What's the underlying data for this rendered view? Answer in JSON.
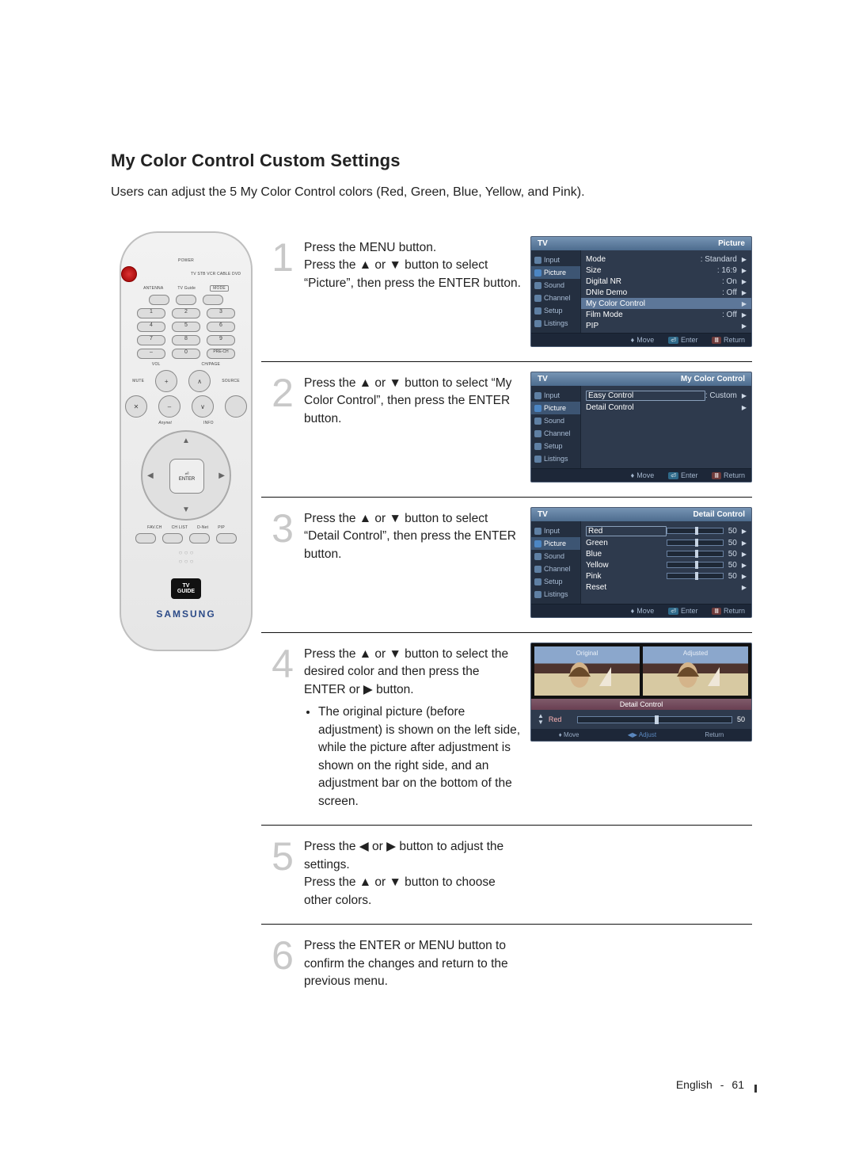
{
  "title": "My Color Control Custom Settings",
  "intro": "Users can adjust the 5 My Color Control colors (Red, Green, Blue, Yellow, and Pink).",
  "remote": {
    "power": "POWER",
    "devices": "TV  STB  VCR  CABLE  DVD",
    "row_labels": [
      "ANTENNA",
      "TV Guide",
      "MODE"
    ],
    "num9": [
      "1",
      "2",
      "3",
      "4",
      "5",
      "6",
      "7",
      "8",
      "9"
    ],
    "bottom3": [
      "–",
      "0",
      "PRE-CH"
    ],
    "col_labels": [
      "VOL",
      "",
      "CH/PAGE"
    ],
    "side_labels": [
      "MUTE",
      "SOURCE"
    ],
    "small_ring": [
      "Anynet",
      "INFO"
    ],
    "nav_center": "ENTER",
    "row4_labels": [
      "FAV.CH",
      "CH LIST",
      "D-Net",
      "PIP"
    ],
    "guide_top": "TV",
    "guide_bottom": "GUIDE",
    "brand": "SAMSUNG"
  },
  "steps": {
    "s1": {
      "num": "1",
      "text": "Press the MENU button.\nPress the ▲ or ▼ button to select “Picture”, then press the ENTER button."
    },
    "s2": {
      "num": "2",
      "text": "Press the ▲ or ▼ button to select “My Color Control”, then press the ENTER button."
    },
    "s3": {
      "num": "3",
      "text": "Press the ▲ or ▼ button to select “Detail Control”, then press the ENTER button."
    },
    "s4": {
      "num": "4",
      "text": "Press the ▲ or ▼ button to select the desired color and then press the ENTER or ▶ button.",
      "bullet": "The original picture (before adjustment) is shown on the left side, while the picture after adjustment is shown on the right side, and an adjustment bar on the bottom of the screen."
    },
    "s5": {
      "num": "5",
      "text": "Press the ◀ or ▶ button to adjust the settings.\nPress the ▲ or ▼ button to choose other colors."
    },
    "s6": {
      "num": "6",
      "text": "Press the ENTER or MENU button to confirm the changes and return to the previous menu."
    }
  },
  "osd_side": [
    "Input",
    "Picture",
    "Sound",
    "Channel",
    "Setup",
    "Listings"
  ],
  "osd_footer": {
    "move": "Move",
    "enter": "Enter",
    "return": "Return"
  },
  "menu1": {
    "hdr_l": "TV",
    "hdr_r": "Picture",
    "items": [
      {
        "lbl": "Mode",
        "val": ": Standard"
      },
      {
        "lbl": "Size",
        "val": ": 16:9"
      },
      {
        "lbl": "Digital NR",
        "val": ": On"
      },
      {
        "lbl": "DNIe Demo",
        "val": ": Off"
      },
      {
        "lbl": "My Color Control",
        "val": "",
        "hilite": true
      },
      {
        "lbl": "Film Mode",
        "val": ": Off"
      },
      {
        "lbl": "PIP",
        "val": ""
      }
    ]
  },
  "menu2": {
    "hdr_l": "TV",
    "hdr_r": "My Color Control",
    "items": [
      {
        "lbl": "Easy Control",
        "val": ": Custom",
        "box": true
      },
      {
        "lbl": "Detail Control",
        "val": ""
      }
    ]
  },
  "menu3": {
    "hdr_l": "TV",
    "hdr_r": "Detail Control",
    "items": [
      {
        "lbl": "Red",
        "val": "50",
        "box": true,
        "bar": 50
      },
      {
        "lbl": "Green",
        "val": "50",
        "bar": 50
      },
      {
        "lbl": "Blue",
        "val": "50",
        "bar": 50
      },
      {
        "lbl": "Yellow",
        "val": "50",
        "bar": 50
      },
      {
        "lbl": "Pink",
        "val": "50",
        "bar": 50
      },
      {
        "lbl": "Reset",
        "val": ""
      }
    ]
  },
  "menu4": {
    "orig": "Original",
    "adj": "Adjusted",
    "hdr": "Detail Control",
    "color": "Red",
    "value": "50",
    "ftr_move": "Move",
    "ftr_adj": "Adjust",
    "ftr_ret": "Return"
  },
  "footer": {
    "lang": "English",
    "page": "61"
  }
}
